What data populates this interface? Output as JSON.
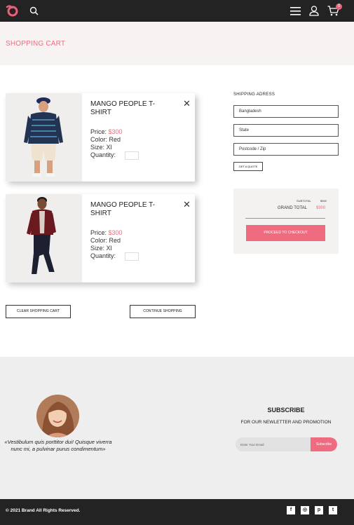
{
  "header": {
    "cart_count": "0",
    "brand_color": "#ef6c80"
  },
  "page_title": "SHOPPING CART",
  "cart": {
    "items": [
      {
        "name": "MANGO PEOPLE T-SHIRT",
        "price_label": "Price:",
        "price": "$300",
        "color_label": "Color:",
        "color": "Red",
        "size_label": "Size:",
        "size": "Xl",
        "quantity_label": "Quantity:",
        "quantity": ""
      },
      {
        "name": "MANGO PEOPLE T-SHIRT",
        "price_label": "Price:",
        "price": "$300",
        "color_label": "Color:",
        "color": "Red",
        "size_label": "Size:",
        "size": "Xl",
        "quantity_label": "Quantity:",
        "quantity": ""
      }
    ],
    "clear_label": "CLEAR SHOPPING CART",
    "continue_label": "CONTINUE SHOPPING"
  },
  "shipping": {
    "title": "SHIPPING ADRESS",
    "country": "Bangladesh",
    "state": "State",
    "postcode": "Postcode / Zip",
    "quote_label": "GET A QUOTE"
  },
  "totals": {
    "subtotal_label": "SUBTOTAL",
    "subtotal_value": "$900",
    "grand_total_label": "GRAND TOTAL",
    "grand_total_value": "$900",
    "checkout_label": "PROCEED TO CHECKOUT"
  },
  "testimonial": {
    "quote": "«Vestibulum quis porttitor dui! Quisque viverra nunc mi, a pulvinar purus condimentum»"
  },
  "newsletter": {
    "title": "SUBSCRIBE",
    "subtitle": "FOR OUR NEWLETTER AND PROMOTION",
    "email_placeholder": "Enter Your Email",
    "button_label": "Subscribe"
  },
  "footer": {
    "copyright": "© 2021 Brand All Rights Reserved.",
    "social": [
      {
        "icon": "facebook-icon",
        "glyph": "f"
      },
      {
        "icon": "instagram-icon",
        "glyph": "◎"
      },
      {
        "icon": "pinterest-icon",
        "glyph": "p"
      },
      {
        "icon": "twitter-icon",
        "glyph": "t"
      }
    ]
  }
}
